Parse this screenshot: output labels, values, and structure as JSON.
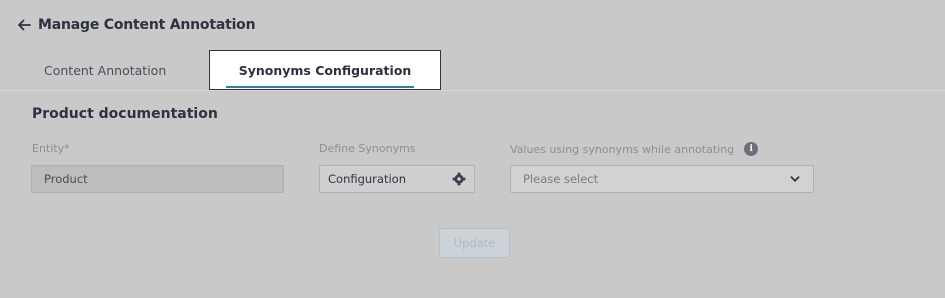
{
  "header": {
    "title": "Manage Content Annotation"
  },
  "tabs": [
    {
      "label": "Content Annotation"
    },
    {
      "label": "Synonyms Configuration"
    }
  ],
  "section": {
    "title": "Product documentation"
  },
  "fields": {
    "entity": {
      "label": "Entity*",
      "value": "Product"
    },
    "define_synonyms": {
      "label": "Define Synonyms",
      "value": "Configuration"
    },
    "values_using_synonyms": {
      "label": "Values using synonyms while annotating",
      "placeholder": "Please select"
    }
  },
  "actions": {
    "update_label": "Update"
  },
  "icons": [
    "back-arrow-icon",
    "info-icon",
    "gear-icon",
    "chevron-down-icon"
  ],
  "colors": {
    "accent": "#2f7fb0",
    "background": "#c9c9c9"
  }
}
